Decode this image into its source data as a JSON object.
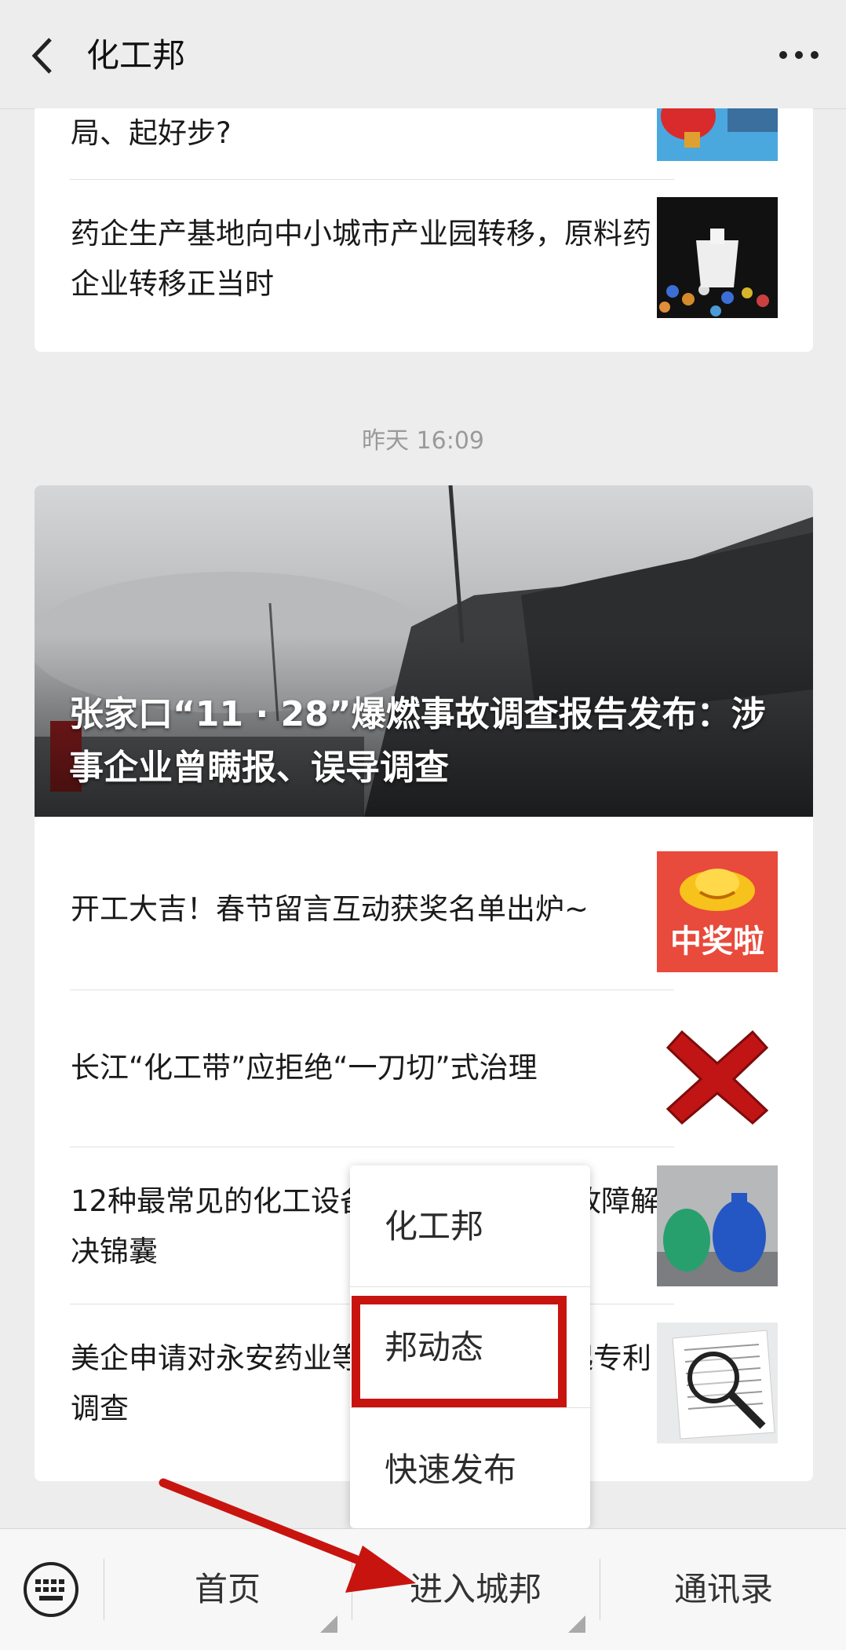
{
  "header": {
    "title": "化工邦"
  },
  "card1": {
    "articles": [
      {
        "title": "局、起好步?"
      },
      {
        "title": "药企生产基地向中小城市产业园转移，原料药企业转移正当时"
      }
    ]
  },
  "timestamp": "昨天 16:09",
  "card2": {
    "hero_title": "张家口“11 · 28”爆燃事故调查报告发布：涉事企业曾瞒报、误导调查",
    "articles": [
      {
        "title": "开工大吉！春节留言互动获奖名单出炉~",
        "thumb_text": "中奖啦"
      },
      {
        "title": "长江“化工带”应拒绝“一刀切”式治理"
      },
      {
        "title": "12种最常见的化工设备故障总结，还有故障解决锦囊"
      },
      {
        "title": "美企申请对永安药业等企业的牛磺酸提起专利调查"
      }
    ]
  },
  "popup_menu": {
    "items": [
      "化工邦",
      "邦动态",
      "快速发布"
    ],
    "highlight_color": "#c8140f"
  },
  "bottom_bar": {
    "items": [
      "首页",
      "进入城邦",
      "通讯录"
    ]
  },
  "colors": {
    "background": "#ededed",
    "accent_red": "#c8140f"
  }
}
